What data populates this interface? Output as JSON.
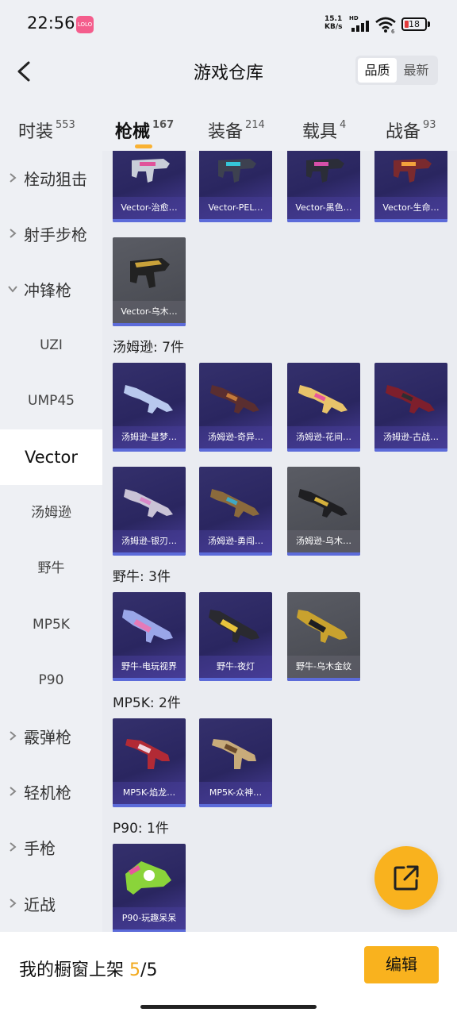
{
  "status": {
    "time": "22:56",
    "app_badge": "LOLO",
    "net_speed": "15.1",
    "net_unit": "KB/s",
    "hd": "HD",
    "wifi_badge": "6",
    "battery": "18"
  },
  "nav": {
    "title": "游戏仓库",
    "sort_options": [
      "品质",
      "最新"
    ]
  },
  "tabs": [
    {
      "label": "时装",
      "count": "553"
    },
    {
      "label": "枪械",
      "count": "167"
    },
    {
      "label": "装备",
      "count": "214"
    },
    {
      "label": "载具",
      "count": "4"
    },
    {
      "label": "战备",
      "count": "93"
    }
  ],
  "sidebar": {
    "categories": [
      "栓动狙击",
      "射手步枪",
      "冲锋枪",
      "霰弹枪",
      "轻机枪",
      "手枪",
      "近战"
    ],
    "subs": [
      "UZI",
      "UMP45",
      "Vector",
      "汤姆逊",
      "野牛",
      "MP5K",
      "P90"
    ]
  },
  "content": {
    "vector_items": [
      "Vector-治愈…",
      "Vector-PEL…",
      "Vector-黑色…",
      "Vector-生命…",
      "Vector-乌木…"
    ],
    "groups": [
      {
        "label": "汤姆逊: 7件",
        "items": [
          "汤姆逊-星梦…",
          "汤姆逊-奇异…",
          "汤姆逊-花间…",
          "汤姆逊-古战…",
          "汤姆逊-银刃…",
          "汤姆逊-勇闯…",
          "汤姆逊-乌木…"
        ]
      },
      {
        "label": "野牛: 3件",
        "items": [
          "野牛-电玩视界",
          "野牛-夜灯",
          "野牛-乌木金纹"
        ]
      },
      {
        "label": "MP5K: 2件",
        "items": [
          "MP5K-焰龙…",
          "MP5K-众神…"
        ]
      },
      {
        "label": "P90: 1件",
        "items": [
          "P90-玩趣呆呆"
        ]
      }
    ]
  },
  "footer": {
    "label": "我的橱窗上架",
    "shelved": "5",
    "separator": "/",
    "total": "5",
    "edit_label": "编辑"
  },
  "colors": {
    "accent": "#f9b21e",
    "card_purple": "#2f2b68",
    "card_gray": "#4e5058",
    "rarity_bar": "#5c6bd9"
  }
}
